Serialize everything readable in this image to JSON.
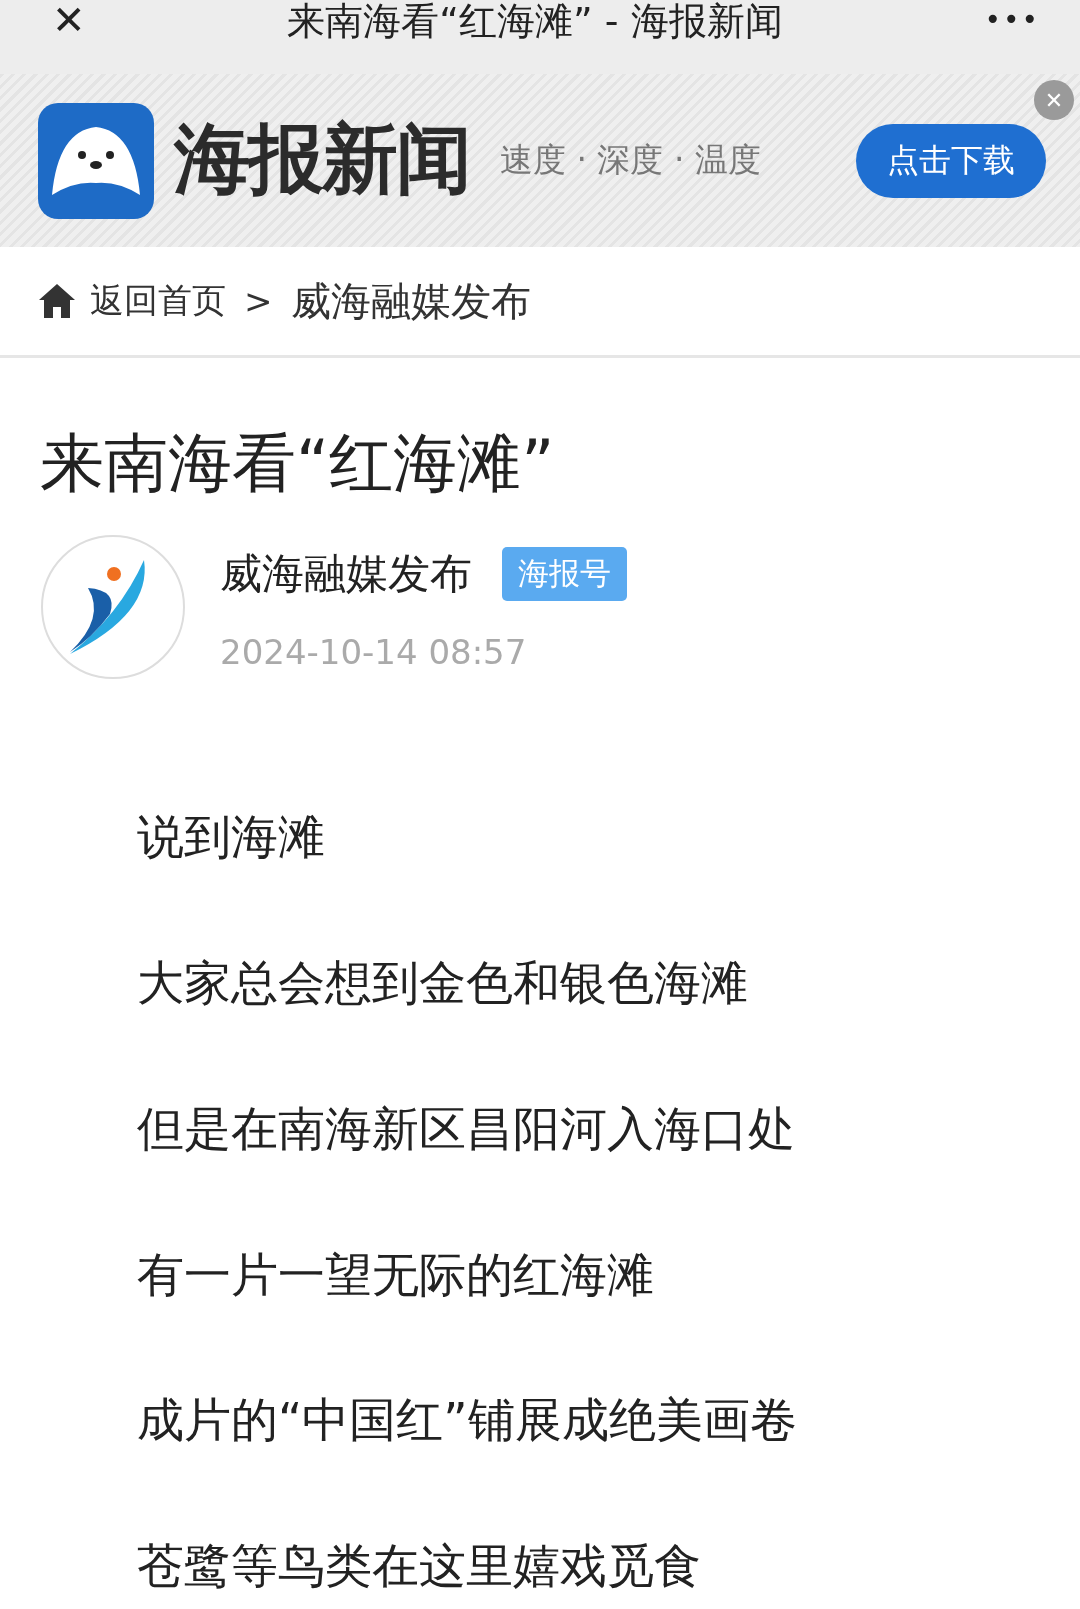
{
  "top_bar": {
    "close": "✕",
    "title": "来南海看“红海滩” - 海报新闻",
    "more": "•••"
  },
  "banner": {
    "app_name": "海报新闻",
    "slogan": "速度 · 深度 · 温度",
    "download_button": "点击下载",
    "dismiss": "✕"
  },
  "breadcrumb": {
    "home": "返回首页",
    "separator": ">",
    "current": "威海融媒发布"
  },
  "article": {
    "title": "来南海看“红海滩”",
    "author": "威海融媒发布",
    "badge": "海报号",
    "date": "2024-10-14 08:57",
    "paragraphs": [
      "说到海滩",
      "大家总会想到金色和银色海滩",
      "但是在南海新区昌阳河入海口处",
      "有一片一望无际的红海滩",
      "成片的“中国红”铺展成绝美画卷",
      "苍鹭等鸟类在这里嬉戏觅食"
    ]
  }
}
